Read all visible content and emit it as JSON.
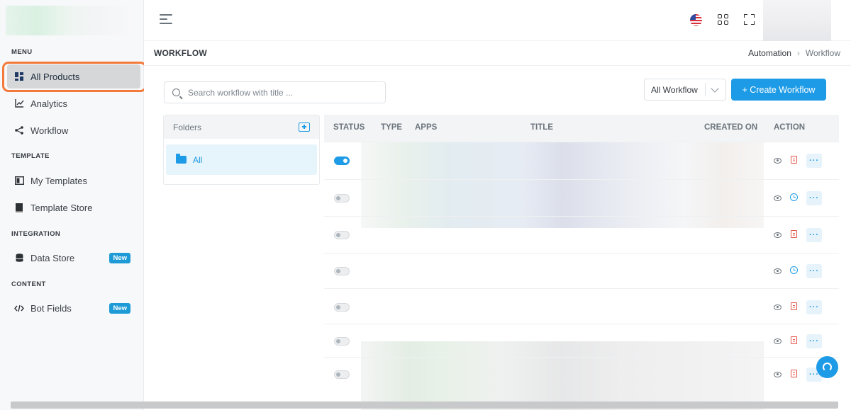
{
  "sidebar": {
    "sections": {
      "menu": "MENU",
      "template": "TEMPLATE",
      "integration": "INTEGRATION",
      "content": "CONTENT"
    },
    "items": [
      {
        "label": "All Products",
        "icon": "dashboard-icon",
        "active": true
      },
      {
        "label": "Analytics",
        "icon": "chart-line-icon"
      },
      {
        "label": "Workflow",
        "icon": "share-nodes-icon"
      },
      {
        "label": "My Templates",
        "icon": "template-icon"
      },
      {
        "label": "Template Store",
        "icon": "book-icon"
      },
      {
        "label": "Data Store",
        "icon": "database-icon",
        "badge": "New"
      },
      {
        "label": "Bot Fields",
        "icon": "code-icon",
        "badge": "New"
      }
    ]
  },
  "topbar": {
    "menu_icon": "hamburger-icon",
    "language_icon": "us-flag-icon",
    "apps_icon": "grid-icon",
    "fullscreen_icon": "fullscreen-icon"
  },
  "page": {
    "title": "WORKFLOW",
    "breadcrumb": [
      "Automation",
      "Workflow"
    ]
  },
  "toolbar": {
    "search_placeholder": "Search workflow with title ...",
    "filter_value": "All Workflow",
    "create_label": "+ Create Workflow"
  },
  "folders": {
    "header": "Folders",
    "items": [
      "All"
    ]
  },
  "table": {
    "columns": [
      "STATUS",
      "TYPE",
      "APPS",
      "TITLE",
      "CREATED ON",
      "ACTION"
    ],
    "rows": [
      {
        "enabled": true,
        "action_icon": "file-icon"
      },
      {
        "enabled": false,
        "action_icon": "history-icon"
      },
      {
        "enabled": false,
        "action_icon": "file-icon"
      },
      {
        "enabled": false,
        "action_icon": "history-icon"
      },
      {
        "enabled": false,
        "action_icon": "file-icon"
      },
      {
        "enabled": false,
        "action_icon": "file-icon"
      },
      {
        "enabled": false,
        "action_icon": "file-icon"
      }
    ],
    "more_label": "···"
  },
  "colors": {
    "accent": "#1e9be6",
    "highlight": "#f47a3c",
    "danger": "#e4564a"
  }
}
